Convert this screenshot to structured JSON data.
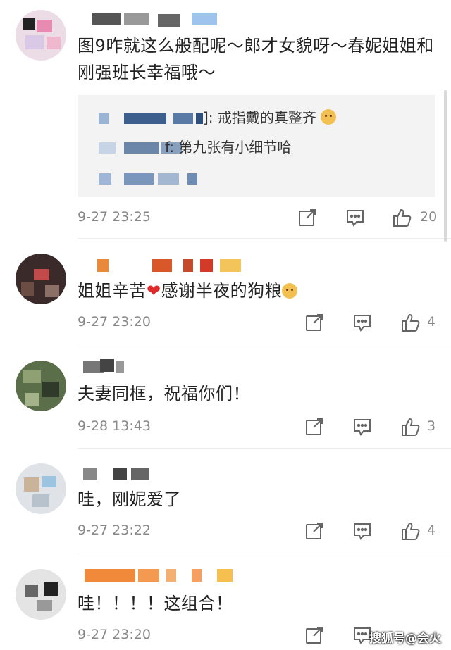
{
  "comments": [
    {
      "text": "图9咋就这么般配呢～郎才女貌呀～春妮姐姐和刚强班长幸福哦～",
      "time": "9-27 23:25",
      "likes": "20",
      "replies": [
        {
          "suffix": "]:",
          "text": "戒指戴的真整齐",
          "emoji": "doge-icon"
        },
        {
          "suffix": "f:",
          "text": "第九张有小细节哈"
        }
      ]
    },
    {
      "text_a": "姐姐辛苦",
      "heart": "❤",
      "text_b": "感谢半夜的狗粮",
      "time": "9-27 23:20",
      "likes": "4"
    },
    {
      "text": "夫妻同框，祝福你们！",
      "time": "9-28 13:43",
      "likes": "3"
    },
    {
      "text": "哇，刚妮爱了",
      "time": "9-27 23:22",
      "likes": "4"
    },
    {
      "text": "哇！！！！这组合！",
      "time": "9-27 23:20",
      "likes": ""
    }
  ],
  "watermark": "搜狐号@会火",
  "colors": {
    "meta_text": "#888888",
    "reply_bg": "#f3f3f3",
    "heart": "#e02a2a"
  }
}
